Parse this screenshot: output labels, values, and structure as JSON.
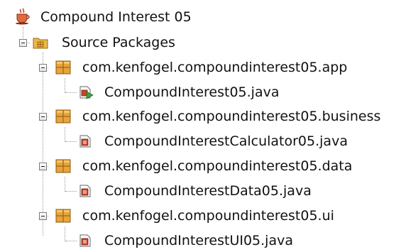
{
  "project": {
    "name": "Compound Interest 05",
    "icon": "java-project-icon"
  },
  "source_packages": {
    "label": "Source Packages",
    "icon": "source-folder-icon"
  },
  "packages": [
    {
      "name": "com.kenfogel.compoundinterest05.app",
      "icon": "package-icon",
      "files": [
        {
          "name": "CompoundInterest05.java",
          "icon": "java-main-class-icon"
        }
      ]
    },
    {
      "name": "com.kenfogel.compoundinterest05.business",
      "icon": "package-icon",
      "files": [
        {
          "name": "CompoundInterestCalculator05.java",
          "icon": "java-class-icon"
        }
      ]
    },
    {
      "name": "com.kenfogel.compoundinterest05.data",
      "icon": "package-icon",
      "files": [
        {
          "name": "CompoundInterestData05.java",
          "icon": "java-class-icon"
        }
      ]
    },
    {
      "name": "com.kenfogel.compoundinterest05.ui",
      "icon": "package-icon",
      "files": [
        {
          "name": "CompoundInterestUI05.java",
          "icon": "java-class-icon"
        }
      ]
    }
  ],
  "colors": {
    "package_icon": "#e8a33a",
    "folder_icon": "#e9b94a",
    "java_icon_red": "#c8442b",
    "main_arrow_green": "#3aa33a"
  }
}
